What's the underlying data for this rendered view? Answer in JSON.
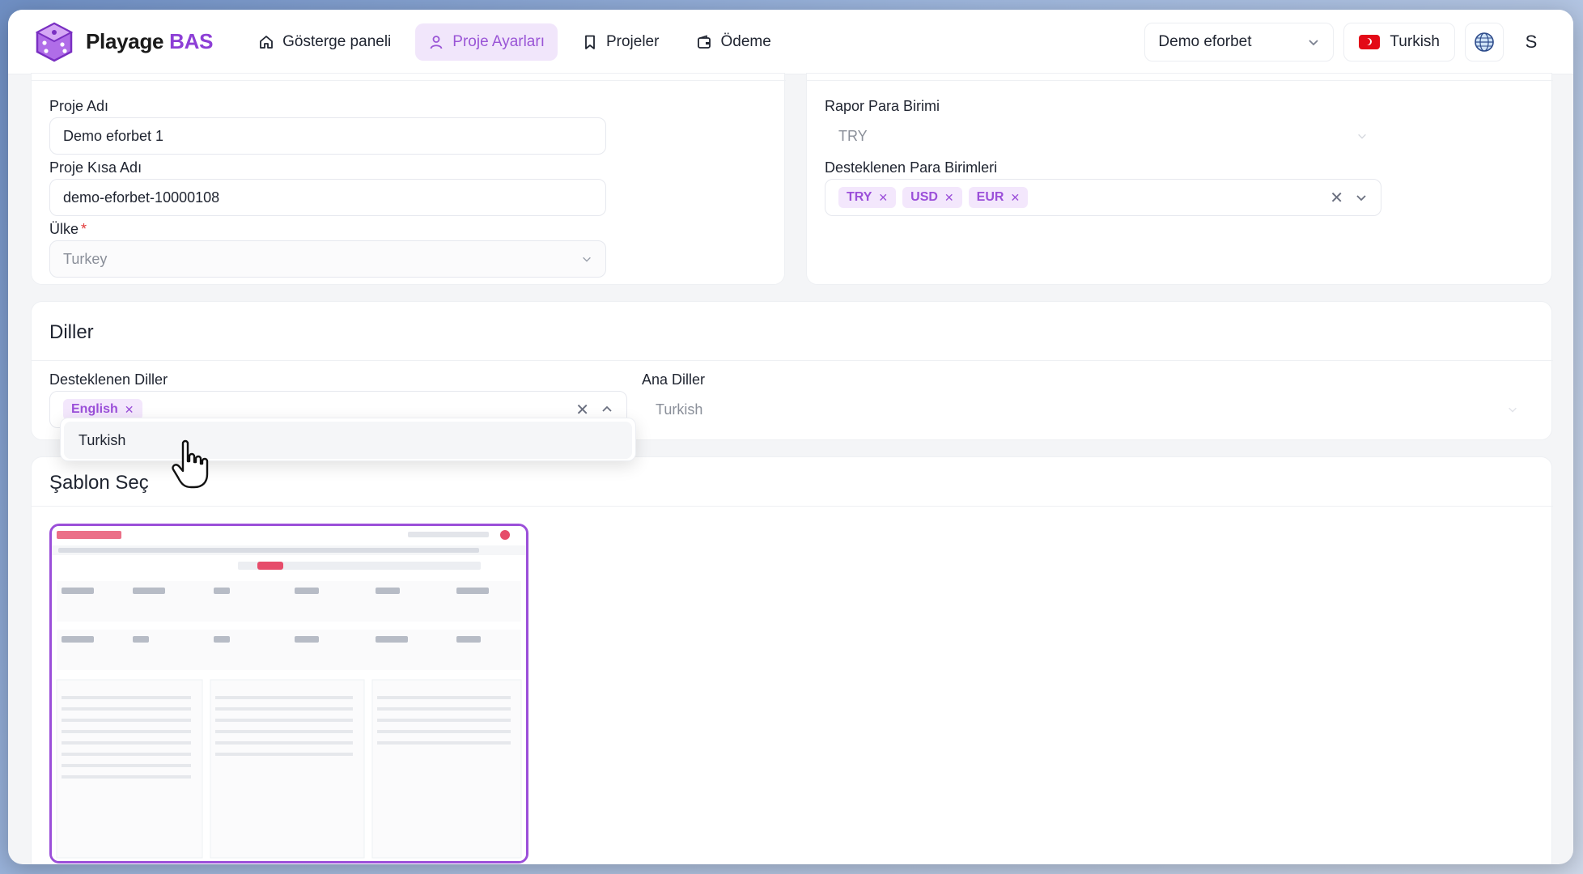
{
  "brand": {
    "name": "Playage",
    "accent": "BAS"
  },
  "nav": {
    "dashboard": "Gösterge paneli",
    "project_settings": "Proje Ayarları",
    "projects": "Projeler",
    "payment": "Ödeme"
  },
  "header": {
    "project_select": "Demo eforbet",
    "language": "Turkish",
    "user_initial": "S"
  },
  "general": {
    "project_name_label": "Proje Adı",
    "project_name_value": "Demo eforbet 1",
    "project_short_label": "Proje Kısa Adı",
    "project_short_value": "demo-eforbet-10000108",
    "country_label": "Ülke",
    "country_required": "*",
    "country_value": "Turkey"
  },
  "currency": {
    "report_label": "Rapor Para Birimi",
    "report_value": "TRY",
    "supported_label": "Desteklenen Para Birimleri",
    "supported_tags": [
      "TRY",
      "USD",
      "EUR"
    ]
  },
  "languages": {
    "title": "Diller",
    "supported_label": "Desteklenen Diller",
    "supported_tags": [
      "English"
    ],
    "main_label": "Ana Diller",
    "main_value": "Turkish",
    "dropdown_options": [
      "Turkish"
    ]
  },
  "template": {
    "title": "Şablon Seç"
  },
  "colors": {
    "accent": "#9b4fd9",
    "accent_bg": "#f3e7fc",
    "required": "#e23b3b"
  }
}
